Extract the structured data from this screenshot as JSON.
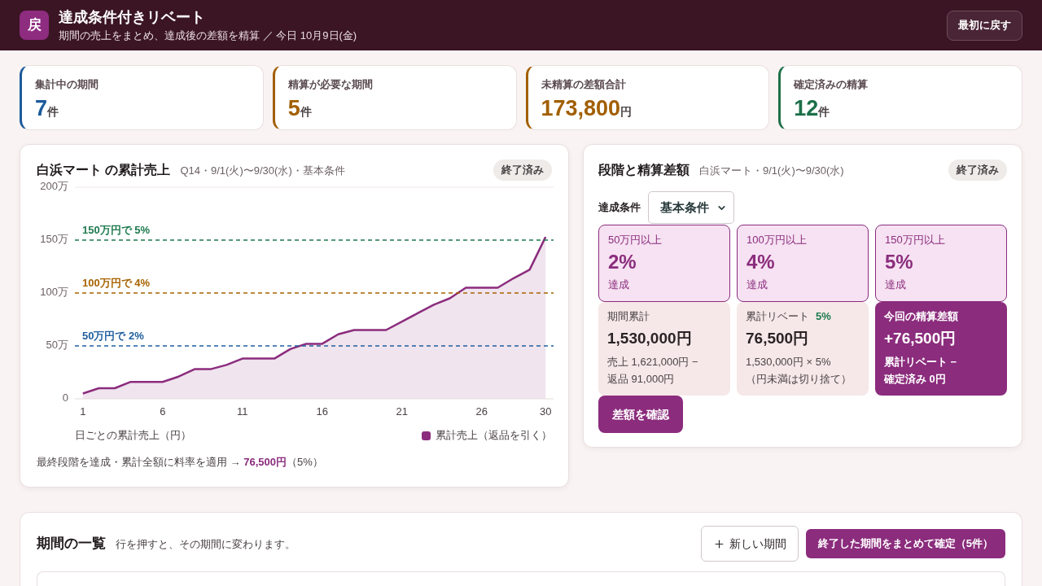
{
  "header": {
    "logo": "戻",
    "title": "達成条件付きリベート",
    "subtitle": "期間の売上をまとめ、達成後の差額を精算 ／ 今日 10月9日(金)",
    "reset_button": "最初に戻す"
  },
  "stats": [
    {
      "label": "集計中の期間",
      "value": "7",
      "unit": "件",
      "color": "#1d5a9c"
    },
    {
      "label": "精算が必要な期間",
      "value": "5",
      "unit": "件",
      "color": "#a15f00"
    },
    {
      "label": "未精算の差額合計",
      "value": "173,800",
      "unit": "円",
      "color": "#a15f00"
    },
    {
      "label": "確定済みの精算",
      "value": "12",
      "unit": "件",
      "color": "#1d7049"
    }
  ],
  "chart_panel": {
    "title": "白浜マート の累計売上",
    "meta": "Q14・9/1(火)〜9/30(水)・基本条件",
    "badge": "終了済み",
    "chart_data": {
      "type": "area",
      "xlabel": "日ごとの累計売上（円）",
      "x": [
        1,
        2,
        3,
        4,
        5,
        6,
        7,
        8,
        9,
        10,
        11,
        12,
        13,
        14,
        15,
        16,
        17,
        18,
        19,
        20,
        21,
        22,
        23,
        24,
        25,
        26,
        27,
        28,
        29,
        30
      ],
      "series": [
        {
          "name": "累計売上（返品を引く）",
          "color": "#8b2c7d",
          "values": [
            5,
            10,
            10,
            16,
            16,
            16,
            21,
            28,
            28,
            32,
            38,
            38,
            38,
            47,
            52,
            52,
            61,
            65,
            65,
            65,
            73,
            81,
            89,
            95,
            105,
            105,
            105,
            114,
            122,
            153
          ]
        }
      ],
      "xlim": [
        0.5,
        30.5
      ],
      "ylim": [
        0,
        200
      ],
      "xticks": [
        1,
        6,
        11,
        16,
        21,
        26,
        30
      ],
      "yticks": [
        {
          "value": 0,
          "label": "0"
        },
        {
          "value": 50,
          "label": "50万"
        },
        {
          "value": 100,
          "label": "100万"
        },
        {
          "value": 150,
          "label": "150万"
        },
        {
          "value": 200,
          "label": "200万"
        }
      ],
      "ref_lines": [
        {
          "axis": "y",
          "value": 150,
          "label": "150万円で 5%",
          "color": "#1e7a4e"
        },
        {
          "axis": "y",
          "value": 100,
          "label": "100万円で 4%",
          "color": "#a76300"
        },
        {
          "axis": "y",
          "value": 50,
          "label": "50万円で 2%",
          "color": "#1f5f9e"
        }
      ]
    },
    "summary": "最終段階を達成・累計全額に料率を適用 → **76,500円**（5%）"
  },
  "tier_panel": {
    "title": "段階と精算差額",
    "meta": "白浜マート・9/1(火)〜9/30(水)",
    "badge": "終了済み",
    "condition": {
      "label": "達成条件",
      "value": "基本条件"
    },
    "tiers": [
      {
        "threshold": "50万円以上",
        "rate": "2%",
        "status": "達成",
        "achieved": true
      },
      {
        "threshold": "100万円以上",
        "rate": "4%",
        "status": "達成",
        "achieved": true
      },
      {
        "threshold": "150万円以上",
        "rate": "5%",
        "status": "達成",
        "achieved": true
      }
    ],
    "summary_cards": [
      {
        "kind": "plain",
        "label": "期間累計",
        "value": "1,530,000円",
        "detail_lines": [
          "売上 1,621,000円 −",
          "返品 91,000円"
        ]
      },
      {
        "kind": "plain",
        "label": "累計リベート",
        "rate": "5%",
        "value": "76,500円",
        "detail_lines": [
          "1,530,000円 × 5%",
          "（円未満は切り捨て）"
        ]
      },
      {
        "kind": "highlight",
        "label": "今回の精算差額",
        "value": "+76,500円",
        "detail_lines": [
          "累計リベート −",
          "確定済み 0円"
        ]
      }
    ],
    "confirm_button": "差額を確認"
  },
  "periods_panel": {
    "title": "期間の一覧",
    "hint": "行を押すと、その期間に変わります。",
    "new_button": "新しい期間",
    "confirm_all_button": "終了した期間をまとめて確定（5件）"
  }
}
